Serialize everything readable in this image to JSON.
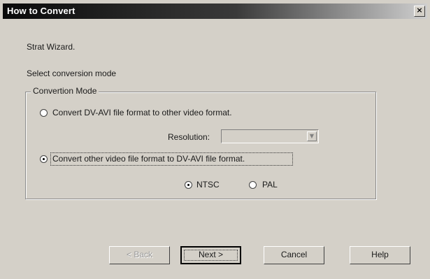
{
  "window": {
    "title": "How to Convert",
    "close_symbol": "×"
  },
  "wizard": {
    "heading": "Strat Wizard.",
    "instruction": "Select conversion mode"
  },
  "mode_group": {
    "label": "Convertion Mode",
    "option_dv_to_other": "Convert DV-AVI file format to other video format.",
    "resolution_label": "Resolution:",
    "resolution_value": "",
    "option_other_to_dv": "Convert other video file format to DV-AVI file format.",
    "selected_option": "other_to_dv",
    "ntsc_label": "NTSC",
    "pal_label": "PAL",
    "selected_standard": "NTSC"
  },
  "buttons": {
    "back": "< Back",
    "next": "Next >",
    "cancel": "Cancel",
    "help": "Help"
  },
  "icons": {
    "close": "close-icon",
    "combo_arrow": "chevron-down-icon"
  }
}
